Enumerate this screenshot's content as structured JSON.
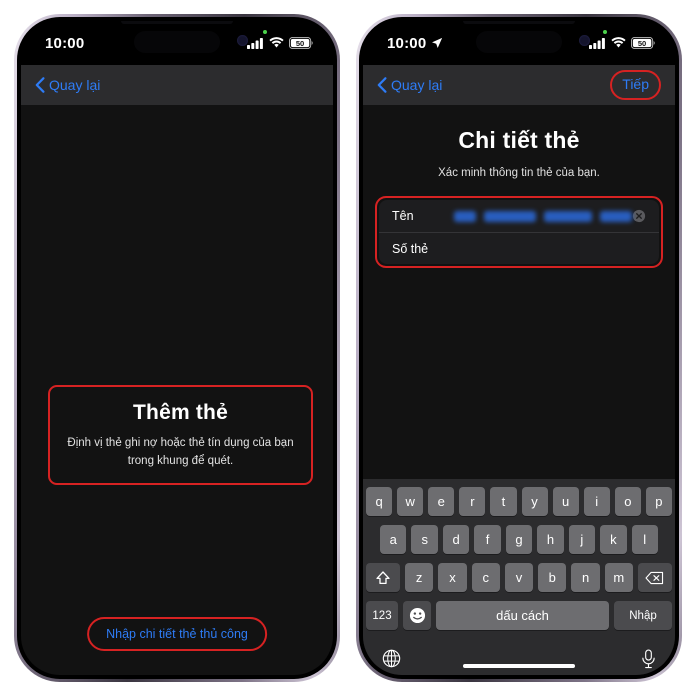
{
  "meta": {
    "accent_blue": "#2e7cf6",
    "annotation_red": "#d62222",
    "screen_bg": "#121212",
    "navbar_bg": "#2c2c2e"
  },
  "phone_left": {
    "status": {
      "time": "10:00",
      "cellular_icon": "cellular-bars-icon",
      "wifi_icon": "wifi-icon",
      "battery_icon": "battery-icon",
      "battery_level": "50",
      "recording_dot": "green-privacy-dot"
    },
    "nav": {
      "back_icon": "chevron-left-icon",
      "back_label": "Quay lại"
    },
    "content": {
      "title": "Thêm thẻ",
      "subtitle": "Định vị thẻ ghi nợ hoặc thẻ tín dụng của bạn trong khung để quét.",
      "manual_button": "Nhập chi tiết thẻ thủ công"
    }
  },
  "phone_right": {
    "status": {
      "time": "10:00",
      "location_icon": "location-arrow-icon",
      "cellular_icon": "cellular-bars-icon",
      "wifi_icon": "wifi-icon",
      "battery_icon": "battery-icon",
      "battery_level": "50",
      "recording_dot": "green-privacy-dot"
    },
    "nav": {
      "back_icon": "chevron-left-icon",
      "back_label": "Quay lại",
      "next_label": "Tiếp"
    },
    "content": {
      "title": "Chi tiết thẻ",
      "subtitle": "Xác minh thông tin thẻ của bạn.",
      "fields": [
        {
          "label": "Tên",
          "value": "",
          "redacted": true,
          "clear_icon": "clear-circle-icon"
        },
        {
          "label": "Số thẻ",
          "value": "",
          "redacted": false,
          "clear_icon": ""
        }
      ]
    },
    "keyboard": {
      "row1": [
        "q",
        "w",
        "e",
        "r",
        "t",
        "y",
        "u",
        "i",
        "o",
        "p"
      ],
      "row2": [
        "a",
        "s",
        "d",
        "f",
        "g",
        "h",
        "j",
        "k",
        "l"
      ],
      "row3": [
        "z",
        "x",
        "c",
        "v",
        "b",
        "n",
        "m"
      ],
      "shift_icon": "shift-arrow-icon",
      "backspace_icon": "backspace-icon",
      "numbers_key": "123",
      "emoji_icon": "emoji-smiley-icon",
      "space_key": "dấu cách",
      "return_key": "Nhập",
      "globe_icon": "globe-icon",
      "mic_icon": "microphone-icon"
    }
  }
}
